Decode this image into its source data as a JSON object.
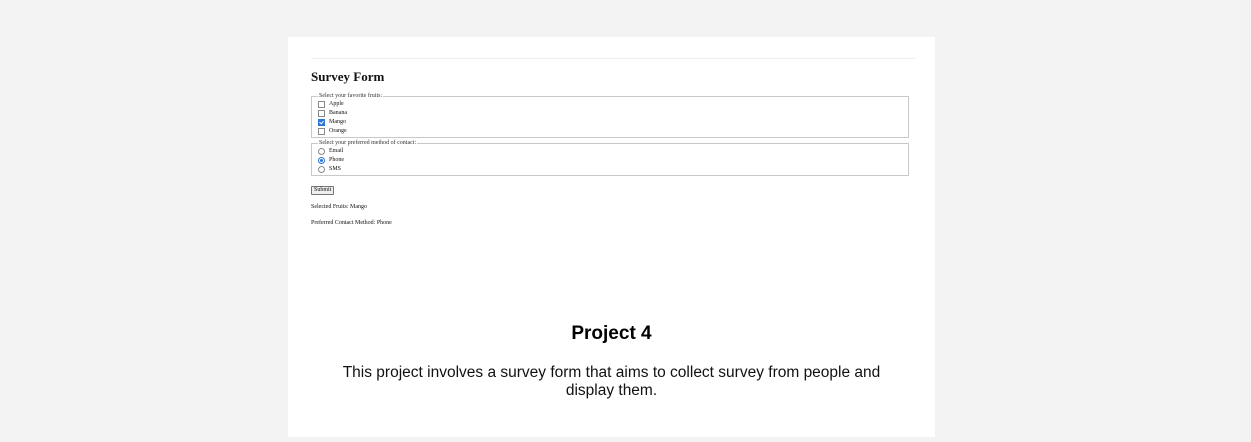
{
  "preview": {
    "form_title": "Survey Form",
    "fruits": {
      "legend": "Select your favorite fruits:",
      "options": [
        {
          "label": "Apple",
          "checked": false
        },
        {
          "label": "Banana",
          "checked": false
        },
        {
          "label": "Mango",
          "checked": true
        },
        {
          "label": "Orange",
          "checked": false
        }
      ]
    },
    "contact": {
      "legend": "Select your preferred method of contact:",
      "options": [
        {
          "label": "Email",
          "checked": false
        },
        {
          "label": "Phone",
          "checked": true
        },
        {
          "label": "SMS",
          "checked": false
        }
      ]
    },
    "submit_label": "Submit",
    "selected_fruits": "Selected Fruits: Mango",
    "preferred_contact": "Preferred Contact Method: Phone"
  },
  "project": {
    "title": "Project 4",
    "description": "This project involves a survey form that aims to collect survey from people and display them."
  },
  "colors": {
    "page_background": "#f3f3f3",
    "card_background": "#ffffff",
    "accent": "#2b73d6"
  }
}
